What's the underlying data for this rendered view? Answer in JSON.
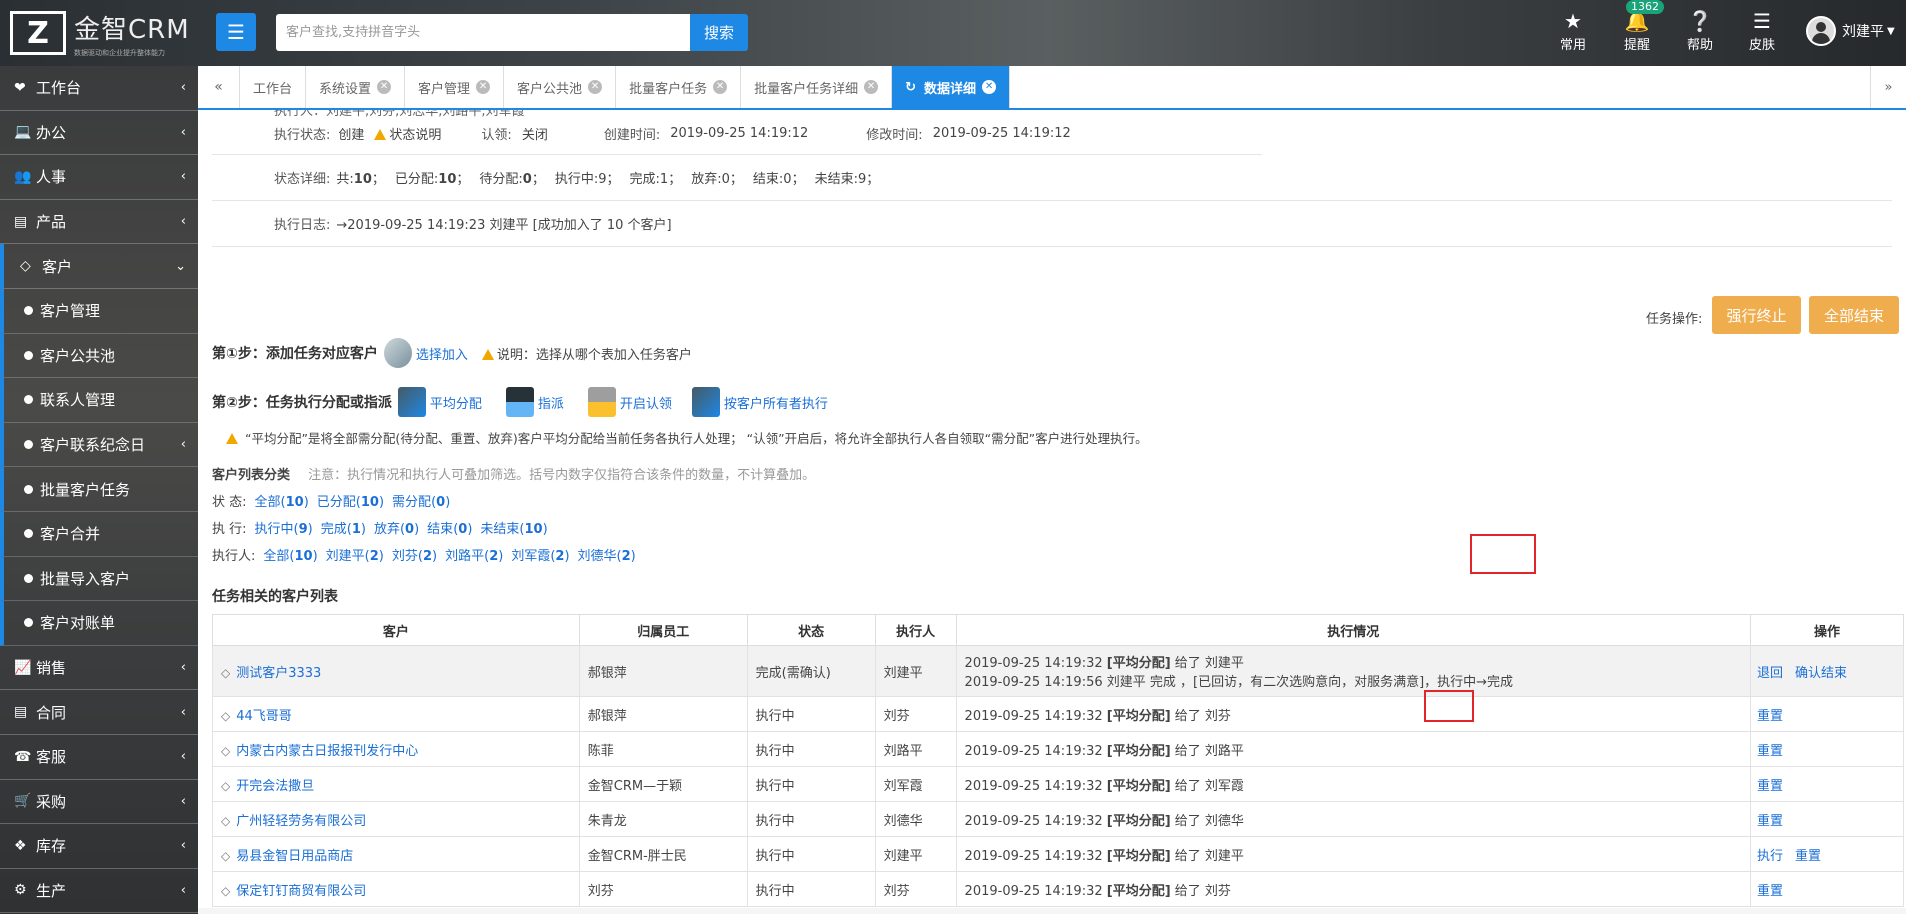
{
  "header": {
    "logo_mark": "Z",
    "logo_name": "金智CRM",
    "logo_slogan": "数据驱动和企业提升整体能力",
    "search_placeholder": "客户查找,支持拼音字头",
    "search_button": "搜索",
    "icons": [
      {
        "icon": "star-icon",
        "label": "常用"
      },
      {
        "icon": "bell-icon",
        "label": "提醒",
        "badge": "1362"
      },
      {
        "icon": "help-icon",
        "label": "帮助"
      },
      {
        "icon": "skin-icon",
        "label": "皮肤"
      }
    ],
    "user_name": "刘建平"
  },
  "sidebar": {
    "items": [
      {
        "icon": "heart-icon",
        "label": "工作台"
      },
      {
        "icon": "laptop-icon",
        "label": "办公"
      },
      {
        "icon": "users-icon",
        "label": "人事"
      },
      {
        "icon": "product-icon",
        "label": "产品"
      },
      {
        "icon": "diamond-icon",
        "label": "客户"
      }
    ],
    "sub_items": [
      "客户管理",
      "客户公共池",
      "联系人管理",
      "客户联系纪念日",
      "批量客户任务",
      "客户合并",
      "批量导入客户",
      "客户对账单"
    ],
    "bottom_items": [
      {
        "icon": "chart-icon",
        "label": "销售"
      },
      {
        "icon": "contract-icon",
        "label": "合同"
      },
      {
        "icon": "phone-icon",
        "label": "客服"
      },
      {
        "icon": "cart-icon",
        "label": "采购"
      },
      {
        "icon": "cubes-icon",
        "label": "库存"
      },
      {
        "icon": "production-icon",
        "label": "生产"
      }
    ]
  },
  "tabs": [
    "工作台",
    "系统设置",
    "客户管理",
    "客户公共池",
    "批量客户任务",
    "批量客户任务详细",
    "数据详细"
  ],
  "detail": {
    "top_partial": "执行人：刘建平,刘芬,刘志华,刘路平,刘军霞",
    "status_label": "执行状态:",
    "status_value": "创建",
    "status_help": "状态说明",
    "claim_label": "认领:",
    "claim_value": "关闭",
    "created_label": "创建时间:",
    "created_value": "2019-09-25 14:19:12",
    "modified_label": "修改时间:",
    "modified_value": "2019-09-25 14:19:12",
    "state_detail_label": "状态详细:",
    "state_detail": [
      {
        "k": "共:",
        "v": "10",
        "bold": true
      },
      {
        "k": "已分配:",
        "v": "10",
        "bold": true
      },
      {
        "k": "待分配:",
        "v": "0",
        "bold": true
      },
      {
        "k": "执行中:",
        "v": "9",
        "bold": false
      },
      {
        "k": "完成:",
        "v": "1",
        "bold": false
      },
      {
        "k": "放弃:",
        "v": "0",
        "bold": false
      },
      {
        "k": "结束:",
        "v": "0",
        "bold": false
      },
      {
        "k": "未结束:",
        "v": "9",
        "bold": false
      }
    ],
    "log_label": "执行日志:",
    "log_value": "→2019-09-25 14:19:23 刘建平 [成功加入了 10 个客户]"
  },
  "task_ops": {
    "label": "任务操作:",
    "force_stop": "强行终止",
    "end_all": "全部结束"
  },
  "step1": {
    "title": "第①步：添加任务对应客户",
    "link": "选择加入",
    "note": "说明：选择从哪个表加入任务客户"
  },
  "step2": {
    "title": "第②步：任务执行分配或指派",
    "links": [
      "平均分配",
      "指派",
      "开启认领",
      "按客户所有者执行"
    ],
    "note": "“平均分配”是将全部需分配(待分配、重置、放弃)客户平均分配给当前任务各执行人处理；  “认领”开启后，将允许全部执行人各自领取“需分配”客户进行处理执行。"
  },
  "filters": {
    "title": "客户列表分类",
    "hint": "注意：执行情况和执行人可叠加筛选。括号内数字仅指符合该条件的数量，不计算叠加。",
    "rows": [
      {
        "label": "状 态:",
        "items": [
          {
            "t": "全部",
            "n": "10"
          },
          {
            "t": "已分配",
            "n": "10"
          },
          {
            "t": "需分配",
            "n": "0"
          }
        ]
      },
      {
        "label": "执 行:",
        "items": [
          {
            "t": "执行中",
            "n": "9"
          },
          {
            "t": "完成",
            "n": "1"
          },
          {
            "t": "放弃",
            "n": "0"
          },
          {
            "t": "结束",
            "n": "0"
          },
          {
            "t": "未结束",
            "n": "10"
          }
        ]
      },
      {
        "label": "执行人:",
        "items": [
          {
            "t": "全部",
            "n": "10"
          },
          {
            "t": "刘建平",
            "n": "2"
          },
          {
            "t": "刘芬",
            "n": "2"
          },
          {
            "t": "刘路平",
            "n": "2"
          },
          {
            "t": "刘军霞",
            "n": "2"
          },
          {
            "t": "刘德华",
            "n": "2"
          }
        ]
      }
    ]
  },
  "table": {
    "title": "任务相关的客户列表",
    "headers": [
      "客户",
      "归属员工",
      "状态",
      "执行人",
      "执行情况",
      "操作"
    ],
    "rows": [
      {
        "customer": "测试客户3333",
        "owner": "郝银萍",
        "status": "完成(需确认)",
        "executor": "刘建平",
        "line1_time": "2019-09-25 14:19:32",
        "line1_tag": "[平均分配]",
        "line1_rest": " 给了 刘建平",
        "line2": "2019-09-25 14:19:56 刘建平 完成 ，[已回访，有二次选购意向，对服务满意]，执行中→完成",
        "ops": [
          "退回",
          "确认结束"
        ]
      },
      {
        "customer": "44飞哥哥",
        "owner": "郝银萍",
        "status": "执行中",
        "executor": "刘芬",
        "line1_time": "2019-09-25 14:19:32",
        "line1_tag": "[平均分配]",
        "line1_rest": " 给了 刘芬",
        "line2": "",
        "ops": [
          "重置"
        ]
      },
      {
        "customer": "内蒙古内蒙古日报报刊发行中心",
        "owner": "陈菲",
        "status": "执行中",
        "executor": "刘路平",
        "line1_time": "2019-09-25 14:19:32",
        "line1_tag": "[平均分配]",
        "line1_rest": " 给了 刘路平",
        "line2": "",
        "ops": [
          "重置"
        ]
      },
      {
        "customer": "开完会法撒旦",
        "owner": "金智CRM—于颖",
        "status": "执行中",
        "executor": "刘军霞",
        "line1_time": "2019-09-25 14:19:32",
        "line1_tag": "[平均分配]",
        "line1_rest": " 给了 刘军霞",
        "line2": "",
        "ops": [
          "重置"
        ]
      },
      {
        "customer": "广州轻轻劳务有限公司",
        "owner": "朱青龙",
        "status": "执行中",
        "executor": "刘德华",
        "line1_time": "2019-09-25 14:19:32",
        "line1_tag": "[平均分配]",
        "line1_rest": " 给了 刘德华",
        "line2": "",
        "ops": [
          "重置"
        ]
      },
      {
        "customer": "易县金智日用品商店",
        "owner": "金智CRM-胖士民",
        "status": "执行中",
        "executor": "刘建平",
        "line1_time": "2019-09-25 14:19:32",
        "line1_tag": "[平均分配]",
        "line1_rest": " 给了 刘建平",
        "line2": "",
        "ops": [
          "执行",
          "重置"
        ]
      },
      {
        "customer": "保定钉钉商贸有限公司",
        "owner": "刘芬",
        "status": "执行中",
        "executor": "刘芬",
        "line1_time": "2019-09-25 14:19:32",
        "line1_tag": "[平均分配]",
        "line1_rest": " 给了 刘芬",
        "line2": "",
        "ops": [
          "重置"
        ]
      }
    ]
  }
}
